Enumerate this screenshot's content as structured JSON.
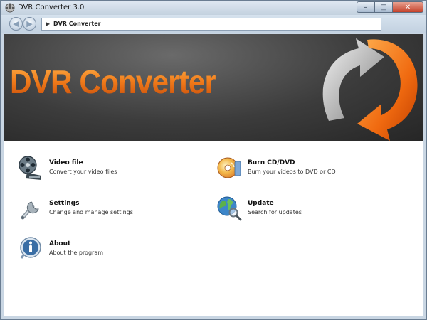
{
  "window": {
    "title": "DVR Converter 3.0",
    "buttons": {
      "minimize": "–",
      "maximize": "□",
      "close": "✕"
    }
  },
  "nav": {
    "back_glyph": "◀",
    "forward_glyph": "▶",
    "breadcrumb_arrow": "▶",
    "breadcrumb": "DVR Converter"
  },
  "banner": {
    "title": "DVR Converter",
    "colors": {
      "accent": "#f07a1a",
      "background": "#3c3c3c"
    }
  },
  "menu": {
    "video": {
      "label": "Video file",
      "description": "Convert your video files",
      "icon": "film-reel-icon"
    },
    "settings": {
      "label": "Settings",
      "description": "Change and manage settings",
      "icon": "wrench-icon"
    },
    "about": {
      "label": "About",
      "description": "About the program",
      "icon": "info-icon"
    },
    "burn": {
      "label": "Burn CD/DVD",
      "description": "Burn your videos to DVD or CD",
      "icon": "disc-icon"
    },
    "update": {
      "label": "Update",
      "description": "Search for updates",
      "icon": "globe-search-icon"
    }
  }
}
